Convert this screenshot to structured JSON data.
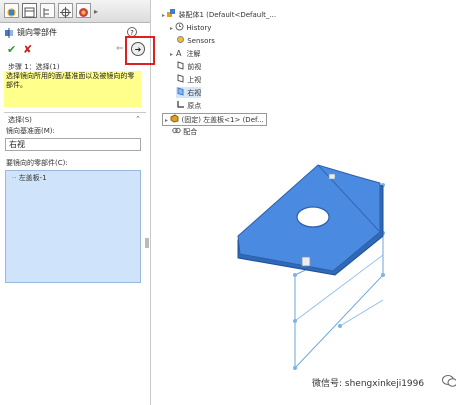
{
  "panel": {
    "title": "镜向零部件",
    "help_text": "?",
    "step": {
      "title": "步骤 1：选择(1)",
      "text": "选择镜向所用的面/基准面以及被镜向的零部件。"
    },
    "selection": {
      "title": "选择(S)",
      "plane_label": "镜向基准面(M):",
      "plane_value": "右视",
      "components_label": "要镜向的零部件(C):",
      "components": [
        "左盖板-1"
      ]
    }
  },
  "tree": {
    "root": "装配体1 (Default<Default_...",
    "items": [
      {
        "label": "History",
        "icon": "history-icon"
      },
      {
        "label": "Sensors",
        "icon": "sensors-icon"
      },
      {
        "label": "注解",
        "icon": "annotations-icon"
      },
      {
        "label": "前视",
        "icon": "plane-icon"
      },
      {
        "label": "上视",
        "icon": "plane-icon"
      },
      {
        "label": "右视",
        "icon": "plane-icon"
      },
      {
        "label": "原点",
        "icon": "origin-icon"
      },
      {
        "label": "(固定) 左盖板<1> (Def...",
        "icon": "part-icon"
      },
      {
        "label": "配合",
        "icon": "mates-icon"
      }
    ]
  },
  "watermark": {
    "text": "微信号: shengxinkeji1996"
  },
  "colors": {
    "accent_red": "#e02020",
    "help_bg": "#ffff8c",
    "list_bg": "#cfe4fa",
    "part_blue": "#3b7fd4"
  }
}
